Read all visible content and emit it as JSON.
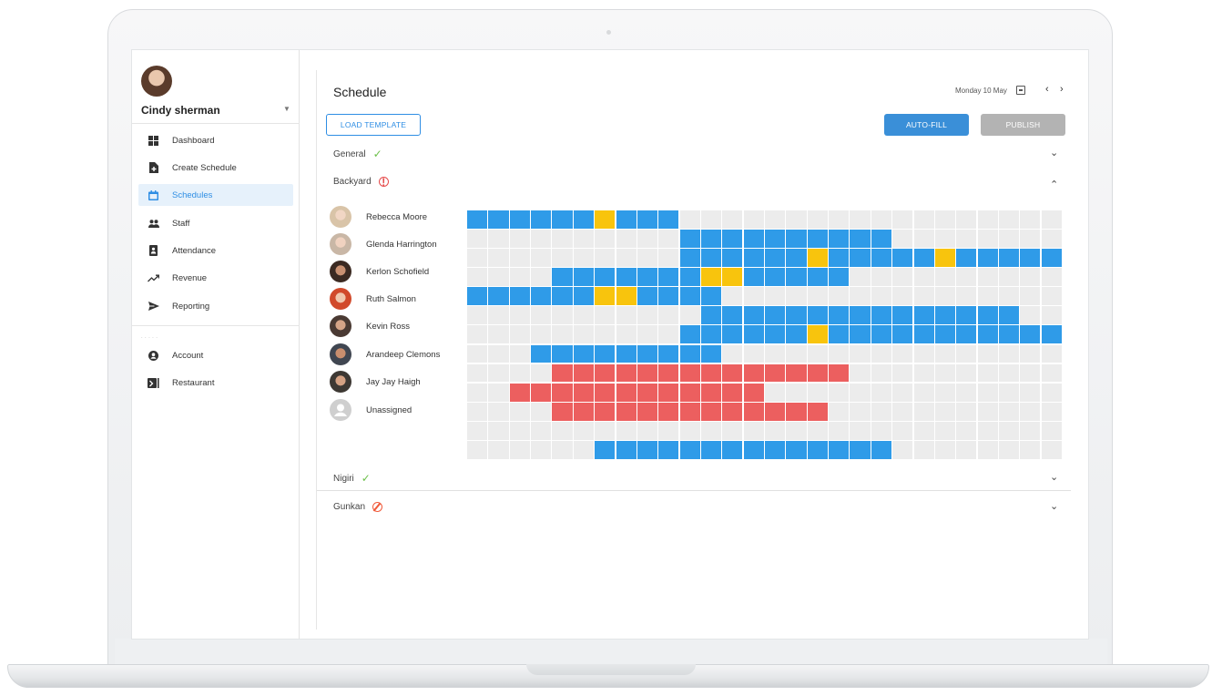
{
  "user": {
    "name": "Cindy sherman"
  },
  "sidebar": {
    "items": [
      {
        "label": "Dashboard",
        "icon": "dashboard-icon"
      },
      {
        "label": "Create Schedule",
        "icon": "create-schedule-icon"
      },
      {
        "label": "Schedules",
        "icon": "calendar-icon",
        "active": true
      },
      {
        "label": "Staff",
        "icon": "staff-icon"
      },
      {
        "label": "Attendance",
        "icon": "attendance-icon"
      },
      {
        "label": "Revenue",
        "icon": "revenue-icon"
      },
      {
        "label": "Reporting",
        "icon": "send-icon"
      }
    ],
    "secondary": [
      {
        "label": "Account",
        "icon": "account-icon"
      },
      {
        "label": "Restaurant",
        "icon": "restaurant-icon"
      }
    ]
  },
  "header": {
    "title": "Schedule",
    "date": "Monday 10 May"
  },
  "toolbar": {
    "load_template": "LOAD TEMPLATE",
    "auto_fill": "AUTO-FILL",
    "publish": "PUBLISH"
  },
  "sections": [
    {
      "name": "General",
      "status": "ok",
      "expanded": false
    },
    {
      "name": "Backyard",
      "status": "warning",
      "expanded": true
    },
    {
      "name": "Nigiri",
      "status": "ok",
      "expanded": false
    },
    {
      "name": "Gunkan",
      "status": "blocked",
      "expanded": false
    }
  ],
  "staff": [
    {
      "name": "Rebecca Moore"
    },
    {
      "name": "Glenda Harrington"
    },
    {
      "name": "Kerlon Schofield"
    },
    {
      "name": "Ruth Salmon"
    },
    {
      "name": "Kevin Ross"
    },
    {
      "name": "Arandeep Clemons"
    },
    {
      "name": "Jay Jay Haigh"
    },
    {
      "name": "Unassigned"
    }
  ],
  "colors": {
    "shift": "#2f9be8",
    "highlight": "#f8c40d",
    "conflict": "#ec5f5f",
    "empty": "#ececec",
    "accent": "#2f8ee4"
  },
  "schedule_grid": {
    "columns": 28,
    "rows": [
      "BBBBBBYBBB..................",
      "..........BBBBBBBBBB........",
      "..........BBBBBBYBBBBBYBBBBB",
      "....BBBBBBBYYBBBBB..........",
      "BBBBBBYYBBBB................",
      "...........BBBBBBBBBBBBBBB..",
      "..........BBBBBBYBBBBBBBBBBB",
      "...BBBBBBBBB................",
      "....RRRRRRRRRRRRRR..........",
      "..RRRRRRRRRRRR..............",
      "....RRRRRRRRRRRRR...........",
      "...........................",
      "......BBBBBBBBBBBBBB........"
    ]
  }
}
